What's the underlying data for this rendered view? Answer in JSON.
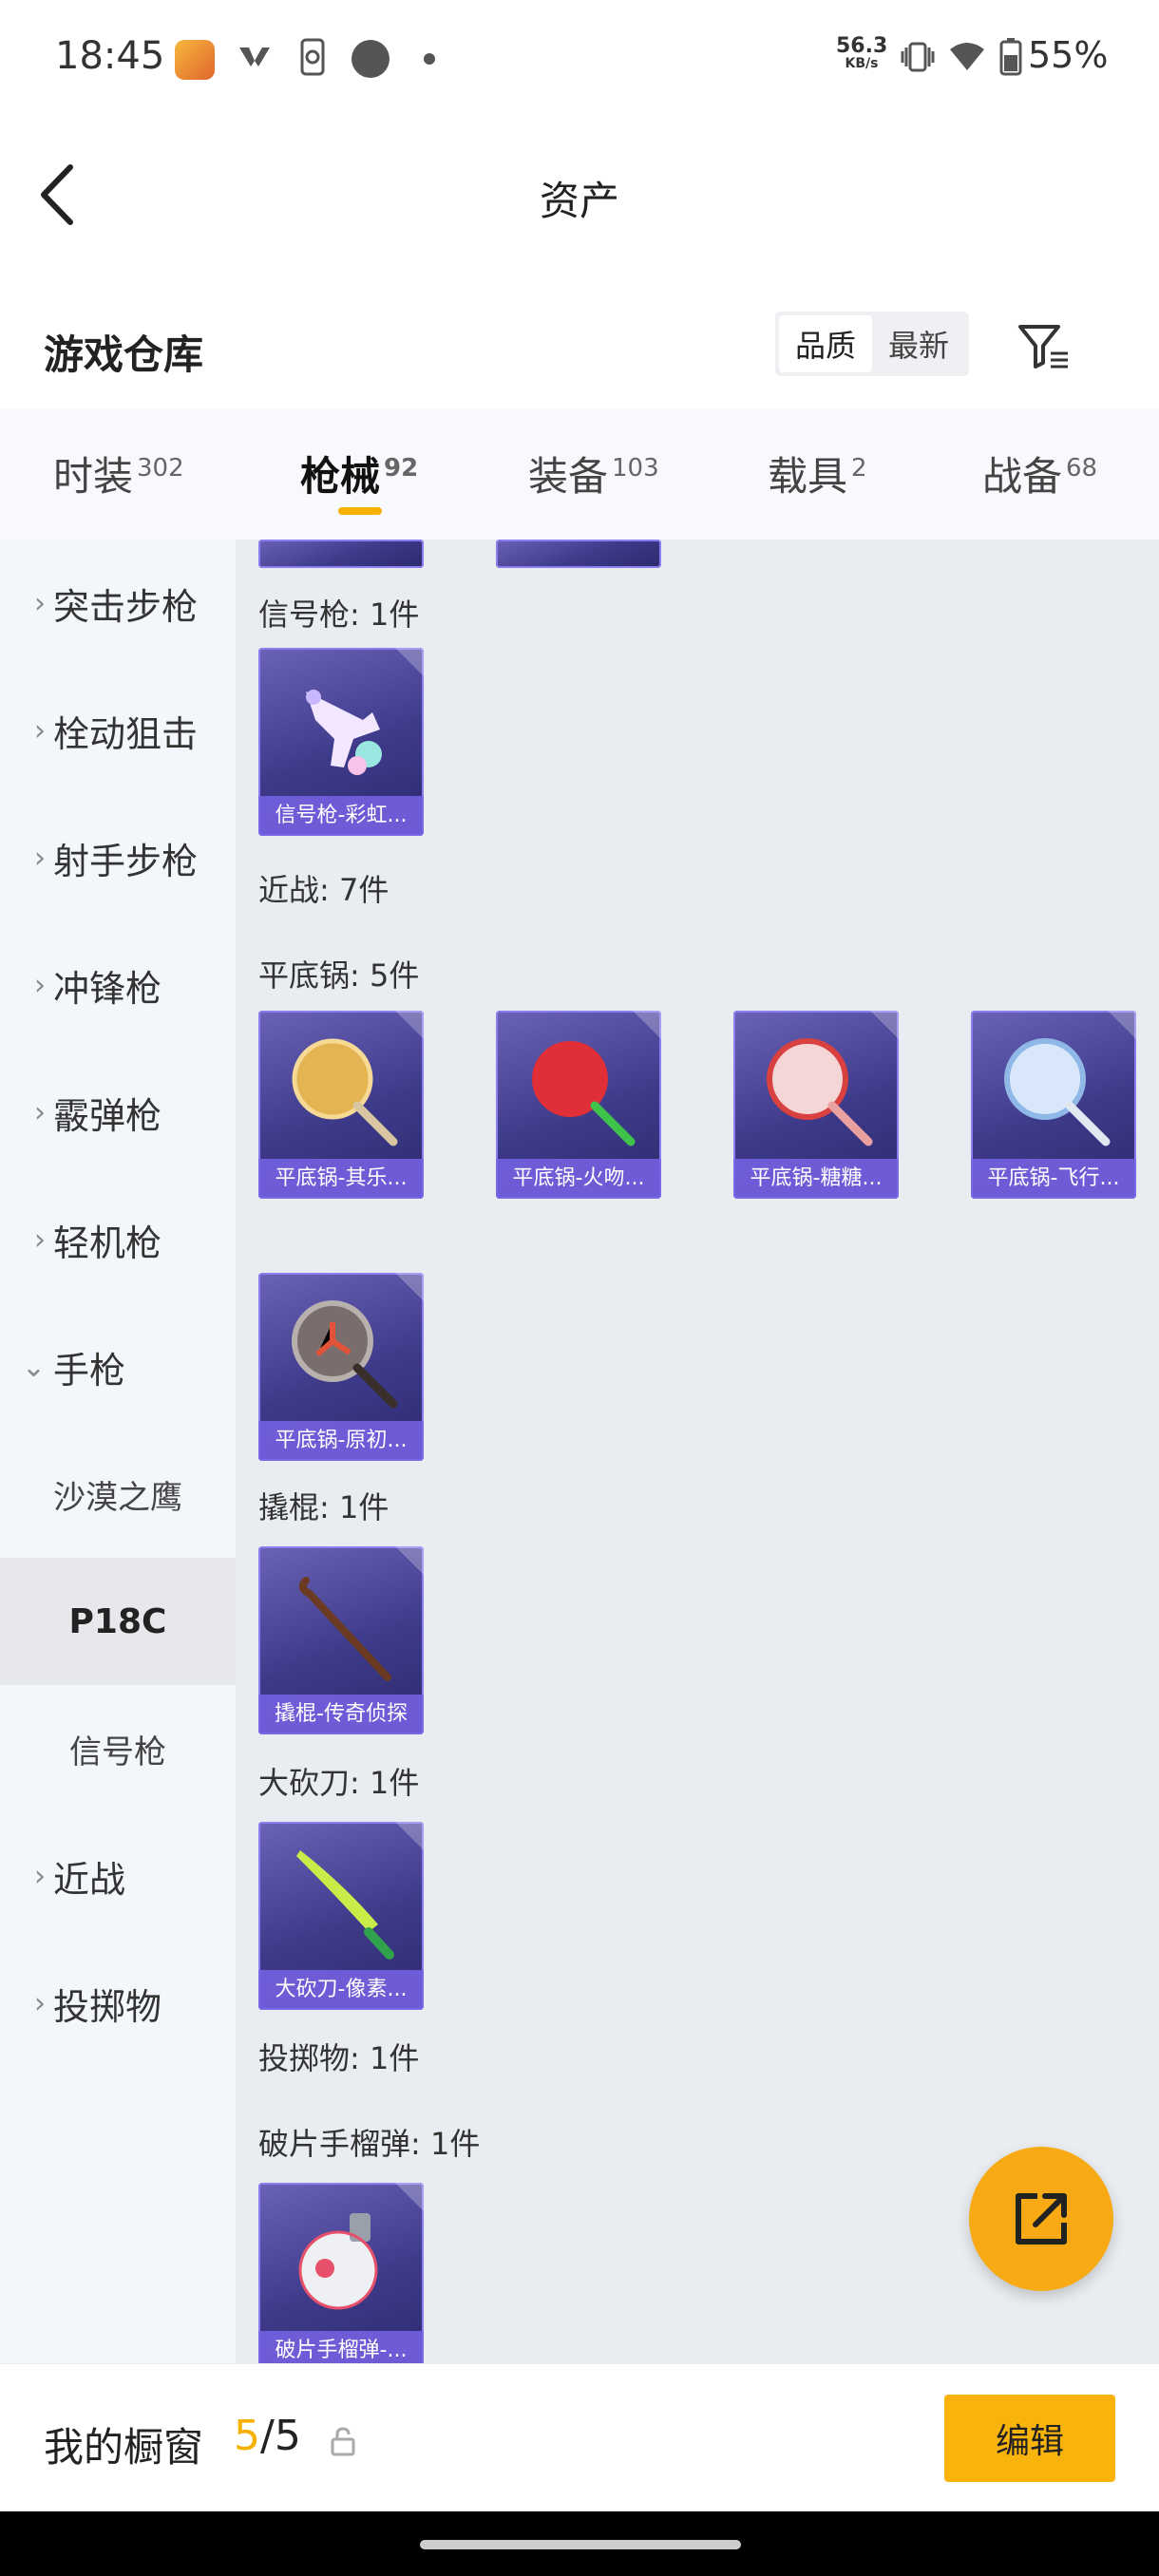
{
  "status_bar": {
    "time": "18:45",
    "speed_value": "56.3",
    "speed_unit": "KB/s",
    "battery": "55%"
  },
  "header": {
    "title": "资产"
  },
  "warehouse": {
    "title": "游戏仓库",
    "sort_options": [
      "品质",
      "最新"
    ],
    "active_sort": "品质"
  },
  "tabs": [
    {
      "label": "时装",
      "count": "302"
    },
    {
      "label": "枪械",
      "count": "92"
    },
    {
      "label": "装备",
      "count": "103"
    },
    {
      "label": "载具",
      "count": "2"
    },
    {
      "label": "战备",
      "count": "68"
    }
  ],
  "active_tab": "枪械",
  "sidebar": {
    "categories": [
      "突击步枪",
      "栓动狙击",
      "射手步枪",
      "冲锋枪",
      "霰弹枪",
      "轻机枪",
      "手枪"
    ],
    "pistol_subitems": [
      "沙漠之鹰",
      "P18C",
      "信号枪"
    ],
    "active_subitem": "P18C",
    "trailing_categories": [
      "近战",
      "投掷物"
    ]
  },
  "content": {
    "sections": {
      "flare_gun": "信号枪: 1件",
      "melee": "近战: 7件",
      "pan": "平底锅: 5件",
      "crowbar": "撬棍: 1件",
      "machete": "大砍刀: 1件",
      "throwables": "投掷物: 1件",
      "frag": "破片手榴弹: 1件"
    },
    "items": {
      "flare_1": "信号枪-彩虹...",
      "pan_1": "平底锅-其乐...",
      "pan_2": "平底锅-火吻...",
      "pan_3": "平底锅-糖糖...",
      "pan_4": "平底锅-飞行...",
      "pan_5": "平底锅-原初...",
      "crowbar_1": "撬棍-传奇侦探",
      "machete_1": "大砍刀-像素...",
      "frag_1": "破片手榴弹-..."
    }
  },
  "bottom_bar": {
    "title": "我的橱窗",
    "current": "5",
    "total": "/5",
    "edit_label": "编辑"
  },
  "colors": {
    "accent": "#f8b40c",
    "card_bg": "#3e3a8a",
    "card_label": "#7864e6",
    "content_bg": "#e9ecf0",
    "sidebar_bg": "#f3f6fb"
  }
}
